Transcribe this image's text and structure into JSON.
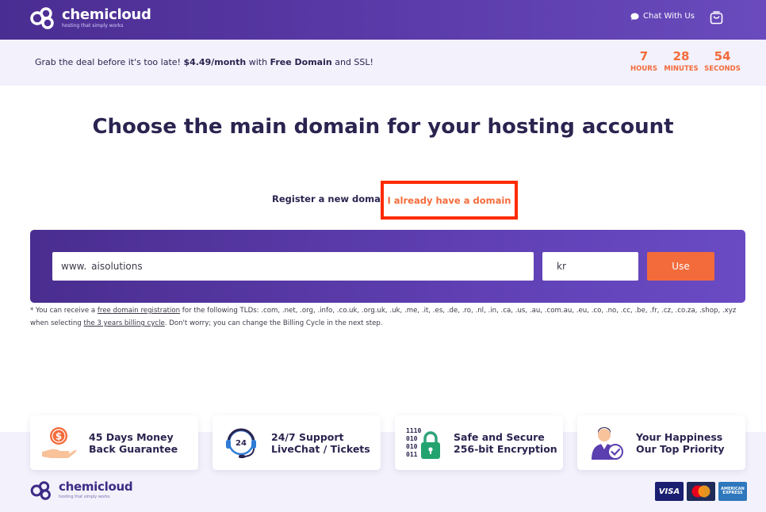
{
  "header": {
    "logo_name": "chemicloud",
    "logo_tagline": "hosting that simply works",
    "chat_label": "Chat With Us"
  },
  "deal": {
    "prefix": "Grab the deal before it's too late! ",
    "price": "$4.49/month",
    "middle": " with ",
    "free_domain": "Free Domain",
    "suffix": " and SSL!",
    "timer": {
      "hours": "7",
      "hours_label": "HOURS",
      "minutes": "28",
      "minutes_label": "MINUTES",
      "seconds": "54",
      "seconds_label": "SECONDS"
    }
  },
  "main": {
    "title": "Choose the main domain for your hosting account",
    "tabs": {
      "register": "Register a new domain",
      "existing": "I already have a domain"
    },
    "search": {
      "prefix": "www.",
      "domain_value": "aisolutions",
      "tld_value": "kr",
      "button_label": "Use"
    },
    "note": {
      "part1": "* You can receive a ",
      "link1": "free domain registration",
      "part2": " for the following TLDs: .com, .net, .org, .info, .co.uk, .org.uk, .uk, .me, .it, .es, .de, .ro, .nl, .in, .ca, .us, .au, .com.au, .eu, .co, .no, .cc, .be, .fr, .cz, .co.za, .shop, .xyz when selecting ",
      "link2": "the 3 years billing cycle",
      "part3": ". Don't worry; you can change the Billing Cycle in the next step."
    }
  },
  "features": [
    {
      "line1": "45 Days Money",
      "line2": "Back Guarantee",
      "icon": "money-back-icon"
    },
    {
      "line1": "24/7 Support",
      "line2": "LiveChat / Tickets",
      "icon": "support-headset-icon"
    },
    {
      "line1": "Safe and Secure",
      "line2": "256-bit Encryption",
      "icon": "lock-icon"
    },
    {
      "line1": "Your Happiness",
      "line2": "Our Top Priority",
      "icon": "happy-user-icon"
    }
  ],
  "footer": {
    "logo_name": "chemicloud",
    "logo_tagline": "hosting that simply works",
    "cards": {
      "visa": "VISA",
      "amex": "AMERICAN EXPRESS"
    }
  },
  "colors": {
    "brand_purple": "#4a2d91",
    "accent_orange": "#f36b3b",
    "highlight_red": "#ff2a00",
    "light_band": "#f3f1fb"
  }
}
